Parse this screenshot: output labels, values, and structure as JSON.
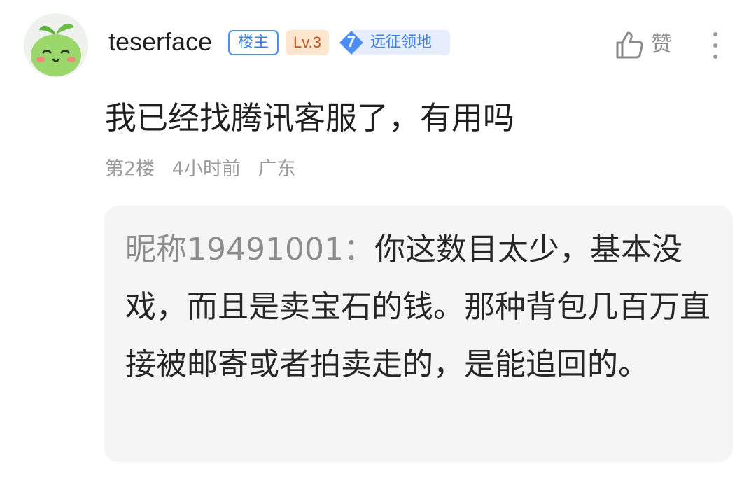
{
  "post": {
    "author": {
      "name": "teserface",
      "owner_badge": "楼主",
      "level_badge": "Lv.3",
      "guild_level": "7",
      "guild_name": "远征领地"
    },
    "like_label": "赞",
    "content": "我已经找腾讯客服了，有用吗",
    "meta": {
      "floor": "第2楼",
      "time": "4小时前",
      "location": "广东"
    },
    "quote": {
      "author": "昵称19491001：",
      "text": "你这数目太少，基本没戏，而且是卖宝石的钱。那种背包几百万直接被邮寄或者拍卖走的，是能追回的。"
    }
  },
  "icons": {
    "avatar": "green-sprout-character-avatar",
    "like": "thumbs-up-icon",
    "more": "vertical-ellipsis-icon",
    "guild": "shield-icon"
  },
  "colors": {
    "accent_blue": "#3b7ff0",
    "level_bg": "#fde6cf",
    "level_text": "#c2581c",
    "meta_gray": "#9b9b9b",
    "quote_bg": "#f5f5f6"
  }
}
